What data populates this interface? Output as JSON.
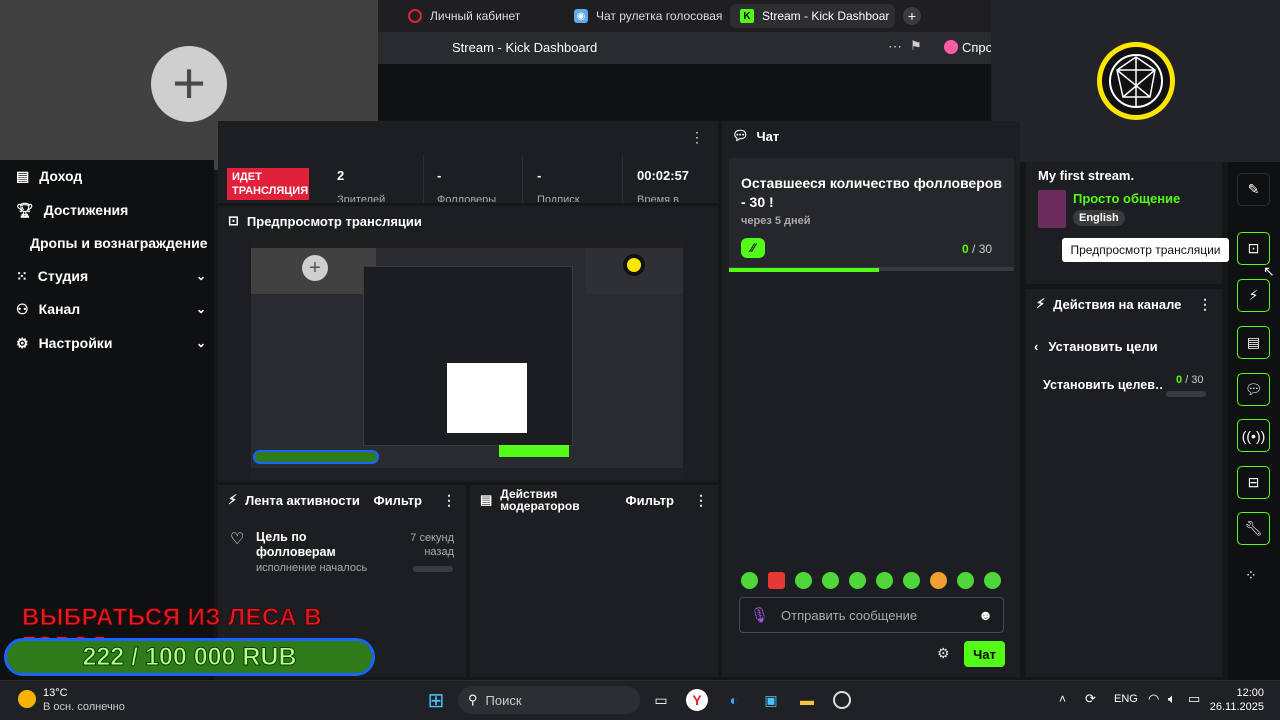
{
  "browser": {
    "tabs": [
      {
        "label": "Личный кабинет",
        "icon": "circle-icon"
      },
      {
        "label": "Чат рулетка голосовая —",
        "icon": "chat-app-icon"
      },
      {
        "label": "Stream - Kick Dashboar",
        "icon": "kick-icon",
        "active": true
      }
    ],
    "page_title": "Stream - Kick Dashboard",
    "extension_label": "Спро"
  },
  "nav": {
    "items": [
      {
        "label": "Доход",
        "icon": "income-icon"
      },
      {
        "label": "Достижения",
        "icon": "trophy-icon"
      },
      {
        "label": "Дропы и вознаграждение"
      },
      {
        "label": "Студия",
        "icon": "studio-icon",
        "expandable": true
      },
      {
        "label": "Канал",
        "icon": "channel-icon",
        "expandable": true
      },
      {
        "label": "Настройки",
        "icon": "gear-icon",
        "expandable": true
      }
    ]
  },
  "status": {
    "live_badge": "ИДЕТ ТРАНСЛЯЦИЯ",
    "viewers_value": "2",
    "viewers_label": "Зрителей",
    "followers_value": "-",
    "followers_label": "Фолловеры",
    "subs_value": "-",
    "subs_label": "Подписк",
    "time_value": "00:02:57",
    "time_label": "Время в"
  },
  "preview": {
    "title": "Предпросмотр трансляции"
  },
  "activity": {
    "title": "Лента активности",
    "filter": "Фильтр",
    "item_title": "Цель по фолловерам",
    "item_sub": "исполнение началось",
    "item_time": "7 секунд назад"
  },
  "moderators": {
    "title": "Действия модераторов",
    "filter": "Фильтр"
  },
  "chat": {
    "title": "Чат",
    "goal_title": "Оставшееся количество фолловеров - 30 !",
    "goal_sub": "через 5 дней",
    "goal_current": "0",
    "goal_total": "/ 30",
    "goal_progress": 0.0,
    "placeholder": "Отправить сообщение",
    "send_label": "Чат"
  },
  "stream_info": {
    "title": "My first stream.",
    "category": "Просто общение",
    "language": "English"
  },
  "channel_actions": {
    "title": "Действия на канале",
    "back_label": "Установить цели",
    "goal_label": "Установить целев…",
    "goal_current": "0",
    "goal_total": "/ 30"
  },
  "tooltip": "Предпросмотр трансляции",
  "overlay": {
    "goal_title": "ВЫБРАТЬСЯ ИЗ ЛЕСА В ГОРОД",
    "goal_amount": "222 / 100 000 RUB"
  },
  "taskbar": {
    "weather_temp": "13°C",
    "weather_desc": "В осн. солнечно",
    "search_placeholder": "Поиск",
    "lang": "ENG",
    "time": "12:00",
    "date": "26.11.2025"
  },
  "colors": {
    "accent": "#53fc18",
    "live": "#e1213a"
  }
}
